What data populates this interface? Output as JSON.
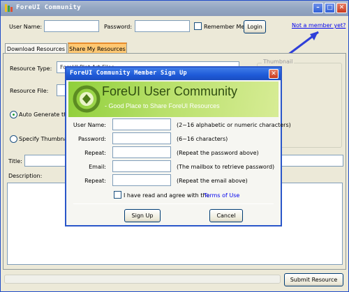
{
  "window": {
    "title": "ForeUI Community"
  },
  "login": {
    "username_label": "User Name:",
    "username_value": "",
    "password_label": "Password:",
    "password_value": "",
    "remember_label": "Remember Me",
    "login_button": "Login",
    "signup_link": "Not a member yet?"
  },
  "tabs": [
    {
      "label": "Download Resources",
      "active": false
    },
    {
      "label": "Share My Resources",
      "active": true
    }
  ],
  "form": {
    "resource_type_label": "Resource Type:",
    "resource_type_value": "ForeUI Plot Art Files",
    "resource_file_label": "Resource File:",
    "auto_generate_label": "Auto Generate the",
    "specify_thumbnail_label": "Specify Thumbnail",
    "thumbnail_group_label": "Thumbnail",
    "title_label": "Title:",
    "description_label": "Description:",
    "submit_button": "Submit Resource"
  },
  "dialog": {
    "title": "ForeUI Community Member Sign Up",
    "banner_title": "ForeUI User Community",
    "banner_subtitle": "- Good Place to Share ForeUI Resources",
    "fields": [
      {
        "label": "User Name:",
        "hint": "(2~16 alphabetic or numeric characters)"
      },
      {
        "label": "Password:",
        "hint": "(6~16 characters)"
      },
      {
        "label": "Repeat:",
        "hint": "(Repeat the password above)"
      },
      {
        "label": "Email:",
        "hint": "(The mailbox to retrieve password)"
      },
      {
        "label": "Repeat:",
        "hint": "(Repeat the email above)"
      }
    ],
    "agree_text": "I have read and agree with the",
    "terms_link": "Terms of Use",
    "signup_button": "Sign Up",
    "cancel_button": "Cancel"
  },
  "colors": {
    "titlebar": "#93a6c2",
    "dialog_titlebar": "#1e5ad8",
    "banner_green": "#8fcf3a",
    "active_tab": "#ffc873",
    "link": "#0000ee",
    "annotation_arrow": "#2f3fd8"
  },
  "icons": {
    "app_icon": "palette-icon",
    "minimize": "minimize-icon",
    "maximize": "maximize-icon",
    "close": "close-icon",
    "banner_logo": "foreui-logo-icon",
    "arrow": "arrow-annotation-icon"
  }
}
